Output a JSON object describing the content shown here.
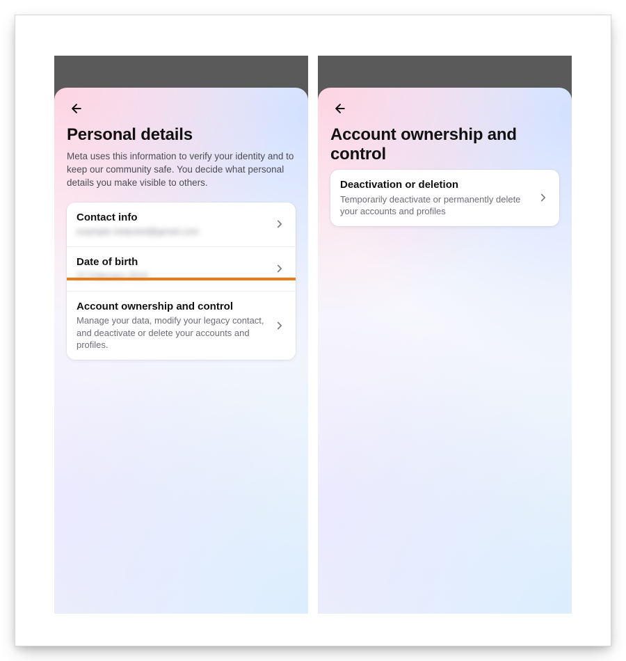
{
  "colors": {
    "highlight": "#e87a17"
  },
  "left": {
    "title": "Personal details",
    "description": "Meta uses this information to verify your identity and to keep our community safe. You decide what personal details you make visible to others.",
    "rows": [
      {
        "title": "Contact info",
        "subtitle": "example.redacted@gmail.com",
        "blurred": true
      },
      {
        "title": "Date of birth",
        "subtitle": "27 February 2016",
        "blurred": true
      },
      {
        "title": "Account ownership and control",
        "subtitle": "Manage your data, modify your legacy contact, and deactivate or delete your accounts and profiles.",
        "blurred": false,
        "highlighted": true
      }
    ]
  },
  "right": {
    "title": "Account ownership and control",
    "rows": [
      {
        "title": "Deactivation or deletion",
        "subtitle": "Temporarily deactivate or permanently delete your accounts and profiles",
        "highlighted": true
      }
    ]
  }
}
